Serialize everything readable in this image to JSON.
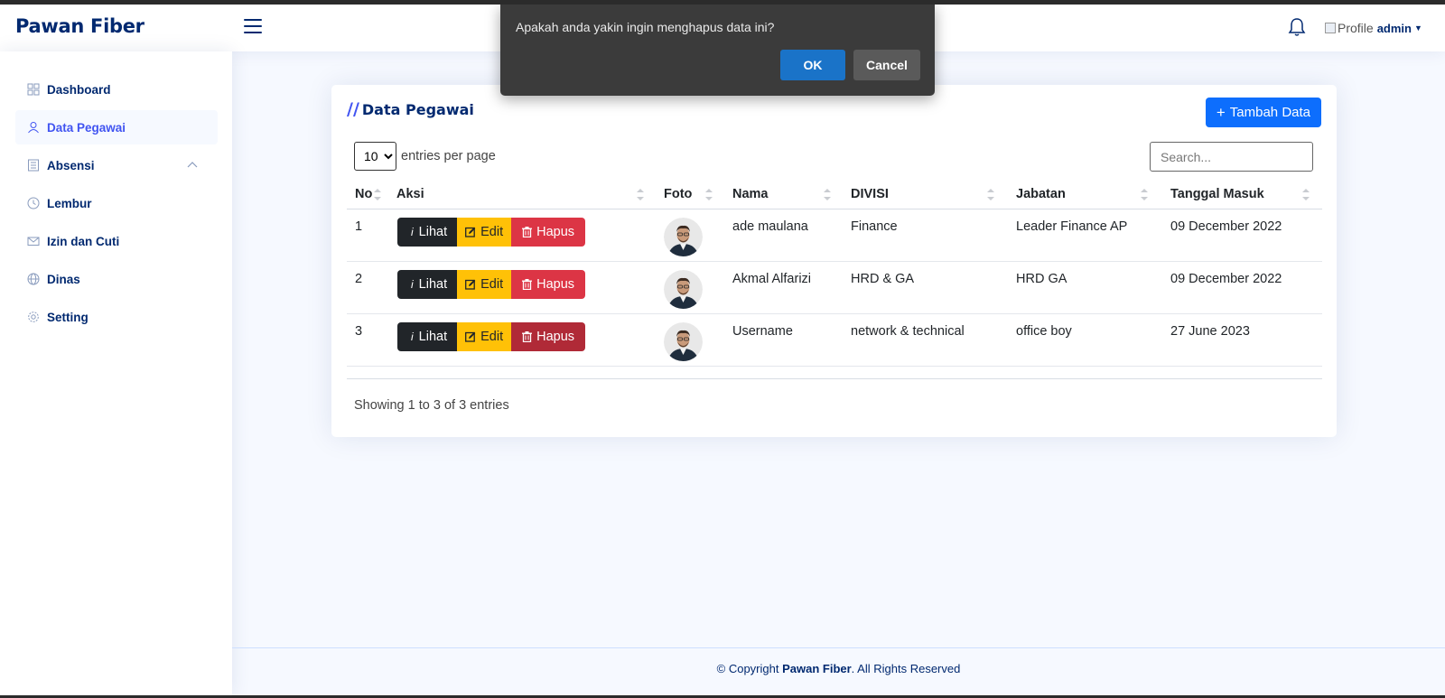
{
  "header": {
    "logo": "Pawan Fiber",
    "profile_alt": "Profile",
    "user": "admin"
  },
  "sidebar": {
    "items": [
      {
        "label": "Dashboard",
        "icon": "grid-icon"
      },
      {
        "label": "Data Pegawai",
        "icon": "person-icon",
        "active": true
      },
      {
        "label": "Absensi",
        "icon": "journal-icon",
        "expanded": true
      },
      {
        "label": "Lembur",
        "icon": "clock-icon"
      },
      {
        "label": "Izin dan Cuti",
        "icon": "envelope-icon"
      },
      {
        "label": "Dinas",
        "icon": "globe-icon"
      },
      {
        "label": "Setting",
        "icon": "gear-icon"
      }
    ]
  },
  "card": {
    "title": "Data Pegawai",
    "add_button": "Tambah Data",
    "entries_value": "10",
    "entries_label": "entries per page",
    "search_placeholder": "Search...",
    "columns": [
      "No",
      "Aksi",
      "Foto",
      "Nama",
      "DIVISI",
      "Jabatan",
      "Tanggal Masuk"
    ],
    "rows": [
      {
        "no": "1",
        "nama": "ade maulana",
        "divisi": "Finance",
        "jabatan": "Leader Finance AP",
        "tanggal": "09 December 2022"
      },
      {
        "no": "2",
        "nama": "Akmal Alfarizi",
        "divisi": "HRD & GA",
        "jabatan": "HRD GA",
        "tanggal": "09 December 2022"
      },
      {
        "no": "3",
        "nama": "Username",
        "divisi": "network & technical",
        "jabatan": "office boy",
        "tanggal": "27 June 2023"
      }
    ],
    "action_labels": {
      "view": "Lihat",
      "edit": "Edit",
      "delete": "Hapus"
    },
    "showing": "Showing 1 to 3 of 3 entries"
  },
  "footer": {
    "prefix": "© Copyright ",
    "brand": "Pawan Fiber",
    "suffix": ". All Rights Reserved"
  },
  "dialog": {
    "message": "Apakah anda yakin ingin menghapus data ini?",
    "ok": "OK",
    "cancel": "Cancel"
  },
  "colors": {
    "primary": "#012970",
    "accent": "#4154f1",
    "button_blue": "#0d6efd",
    "danger": "#dc3545",
    "warning": "#ffc107"
  }
}
